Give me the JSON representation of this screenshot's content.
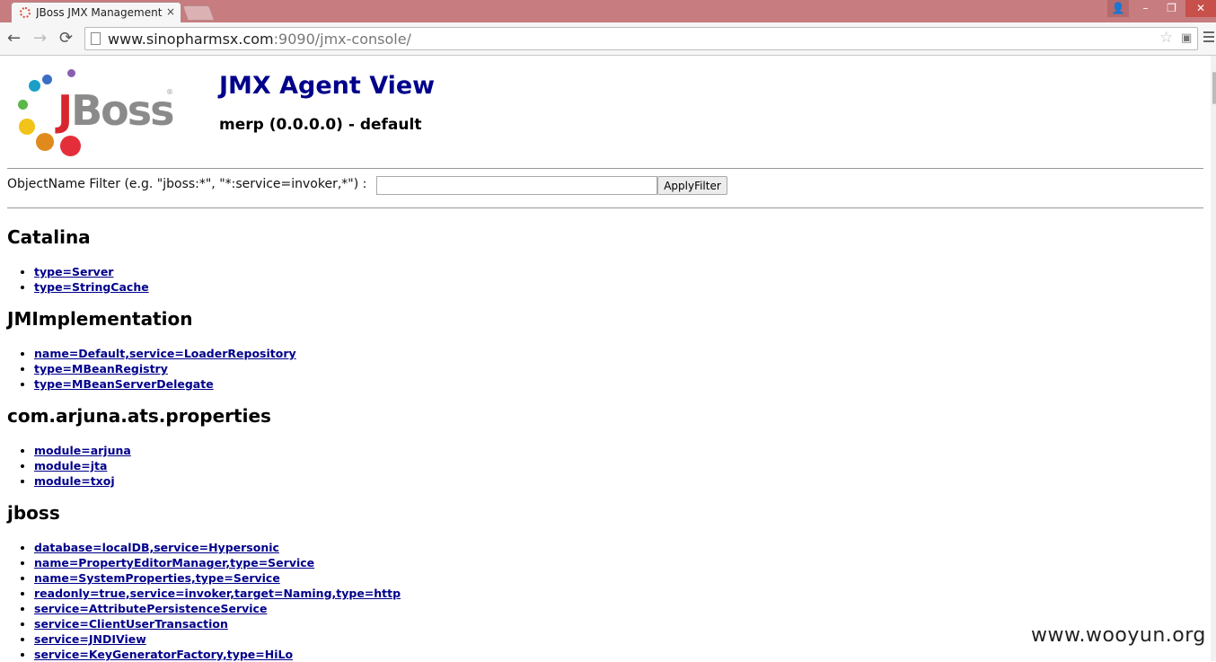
{
  "browser": {
    "tab_title": "JBoss JMX Management",
    "tab_close": "×",
    "url_host": "www.sinopharmsx.com",
    "url_rest": ":9090/jmx-console/",
    "back_icon": "←",
    "forward_icon": "→",
    "reload_icon": "⟳",
    "star_icon": "☆",
    "user_icon": "👤",
    "min_icon": "–",
    "max_icon": "❐",
    "close_icon": "✕"
  },
  "logo": {
    "text_j": "J",
    "text_rest": "Boss",
    "registered": "®"
  },
  "header": {
    "title": "JMX Agent View",
    "subtitle": "merp (0.0.0.0) - default"
  },
  "filter": {
    "label": "ObjectName Filter (e.g. \"jboss:*\", \"*:service=invoker,*\") :",
    "value": "",
    "button": "ApplyFilter"
  },
  "sections": [
    {
      "name": "Catalina",
      "links": [
        "type=Server",
        "type=StringCache"
      ]
    },
    {
      "name": "JMImplementation",
      "links": [
        "name=Default,service=LoaderRepository",
        "type=MBeanRegistry",
        "type=MBeanServerDelegate"
      ]
    },
    {
      "name": "com.arjuna.ats.properties",
      "links": [
        "module=arjuna",
        "module=jta",
        "module=txoj"
      ]
    },
    {
      "name": "jboss",
      "links": [
        "database=localDB,service=Hypersonic",
        "name=PropertyEditorManager,type=Service",
        "name=SystemProperties,type=Service",
        "readonly=true,service=invoker,target=Naming,type=http",
        "service=AttributePersistenceService",
        "service=ClientUserTransaction",
        "service=JNDIView",
        "service=KeyGeneratorFactory,type=HiLo"
      ]
    }
  ],
  "watermark": "www.wooyun.org",
  "colors": {
    "titlebar": "#c77c7f",
    "link": "#00008b",
    "logo_red": "#d8262e"
  }
}
